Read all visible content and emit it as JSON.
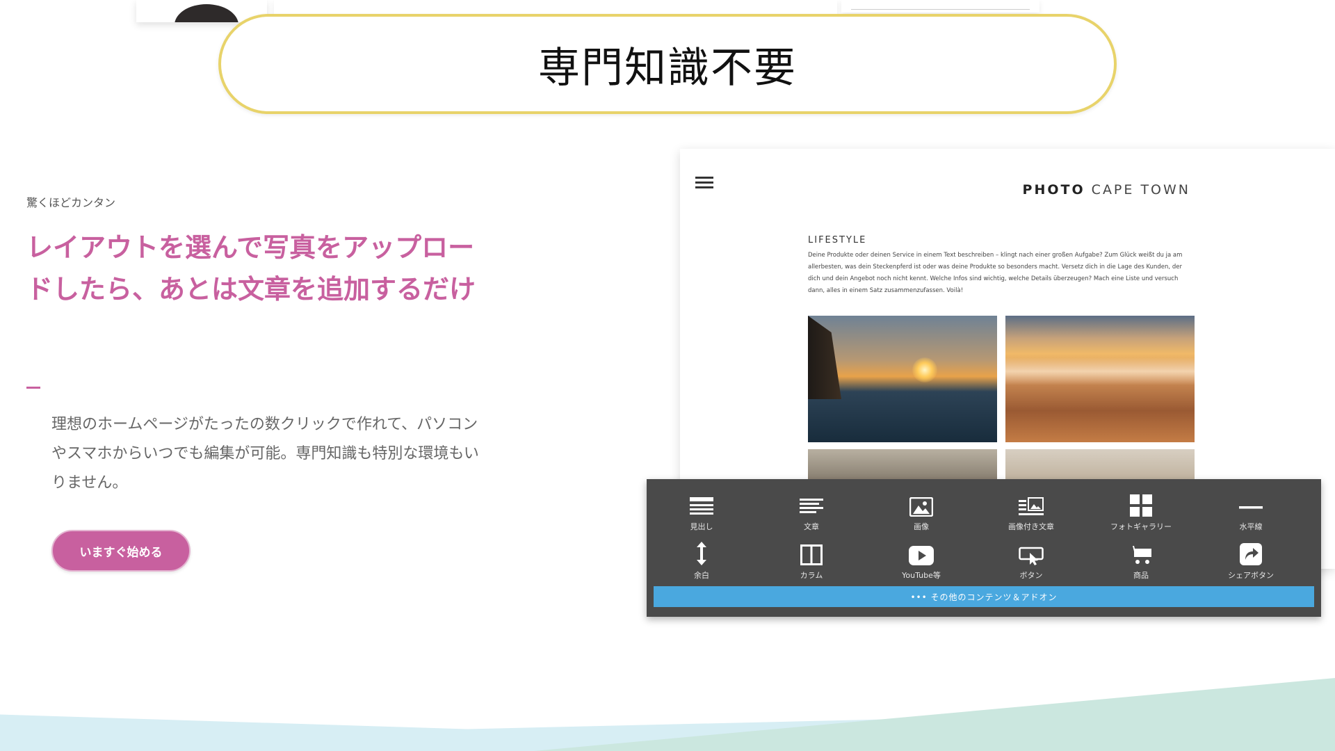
{
  "hero": {
    "title": "専門知識不要"
  },
  "feature": {
    "eyebrow": "驚くほどカンタン",
    "headline": "レイアウトを選んで写真をアップロードしたら、あとは文章を追加するだけ",
    "body": "理想のホームページがたったの数クリックで作れて、パソコンやスマホからいつでも編集が可能。専門知識も特別な環境もいりません。",
    "cta_label": "いますぐ始める"
  },
  "preview": {
    "brand_bold": "PHOTO",
    "brand_light": "CAPE TOWN",
    "section_label": "LIFESTYLE",
    "section_text": "Deine Produkte oder deinen Service in einem Text beschreiben – klingt nach einer großen Aufgabe? Zum Glück weißt du ja am allerbesten, was dein Steckenpferd ist oder was deine Produkte so besonders macht. Versetz dich in die Lage des Kunden, der dich und dein Angebot noch nicht kennt. Welche Infos sind wichtig, welche Details überzeugen? Mach eine Liste und versuch dann, alles in einem Satz zusammenzufassen. Voilà!"
  },
  "toolbar": {
    "items": [
      {
        "label": "見出し",
        "icon": "heading-icon"
      },
      {
        "label": "文章",
        "icon": "text-icon"
      },
      {
        "label": "画像",
        "icon": "image-icon"
      },
      {
        "label": "画像付き文章",
        "icon": "image-text-icon"
      },
      {
        "label": "フォトギャラリー",
        "icon": "gallery-icon"
      },
      {
        "label": "水平線",
        "icon": "horizontal-line-icon"
      },
      {
        "label": "余白",
        "icon": "spacer-icon"
      },
      {
        "label": "カラム",
        "icon": "columns-icon"
      },
      {
        "label": "YouTube等",
        "icon": "video-play-icon"
      },
      {
        "label": "ボタン",
        "icon": "button-cursor-icon"
      },
      {
        "label": "商品",
        "icon": "cart-icon"
      },
      {
        "label": "シェアボタン",
        "icon": "share-icon"
      }
    ],
    "more_label": "••• その他のコンテンツ＆アドオン"
  }
}
